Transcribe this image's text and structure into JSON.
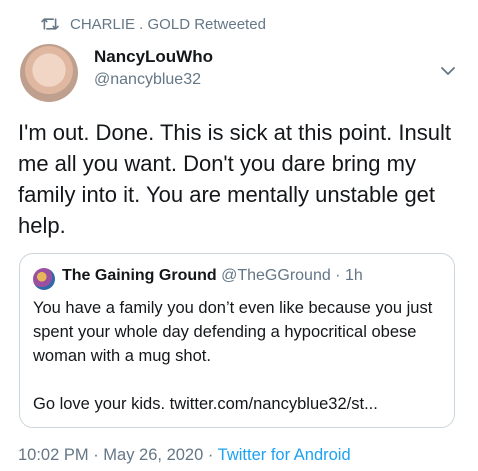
{
  "retweet": {
    "label": "CHARLIE . GOLD Retweeted"
  },
  "author": {
    "name": "NancyLouWho",
    "handle": "@nancyblue32"
  },
  "tweet": {
    "text": "I'm out. Done. This is sick at this point. Insult me all you want. Don't you dare bring my family into it. You are mentally unstable get help."
  },
  "quote": {
    "name": "The Gaining Ground",
    "handle": "@TheGGround",
    "separator": " · ",
    "time": "1h",
    "text_line1": "You have a family you don’t even like because you just spent your whole day defending a hypocritical obese woman with a mug shot.",
    "text_line2": "Go love your kids. twitter.com/nancyblue32/st..."
  },
  "footer": {
    "time": "10:02 PM",
    "sep1": " · ",
    "date": "May 26, 2020",
    "sep2": " · ",
    "source": "Twitter for Android"
  },
  "icons": {
    "retweet": "retweet-icon",
    "caret": "chevron-down-icon"
  },
  "colors": {
    "secondary_text": "#657786",
    "link": "#1da1f2",
    "border": "#ccd6dd"
  }
}
